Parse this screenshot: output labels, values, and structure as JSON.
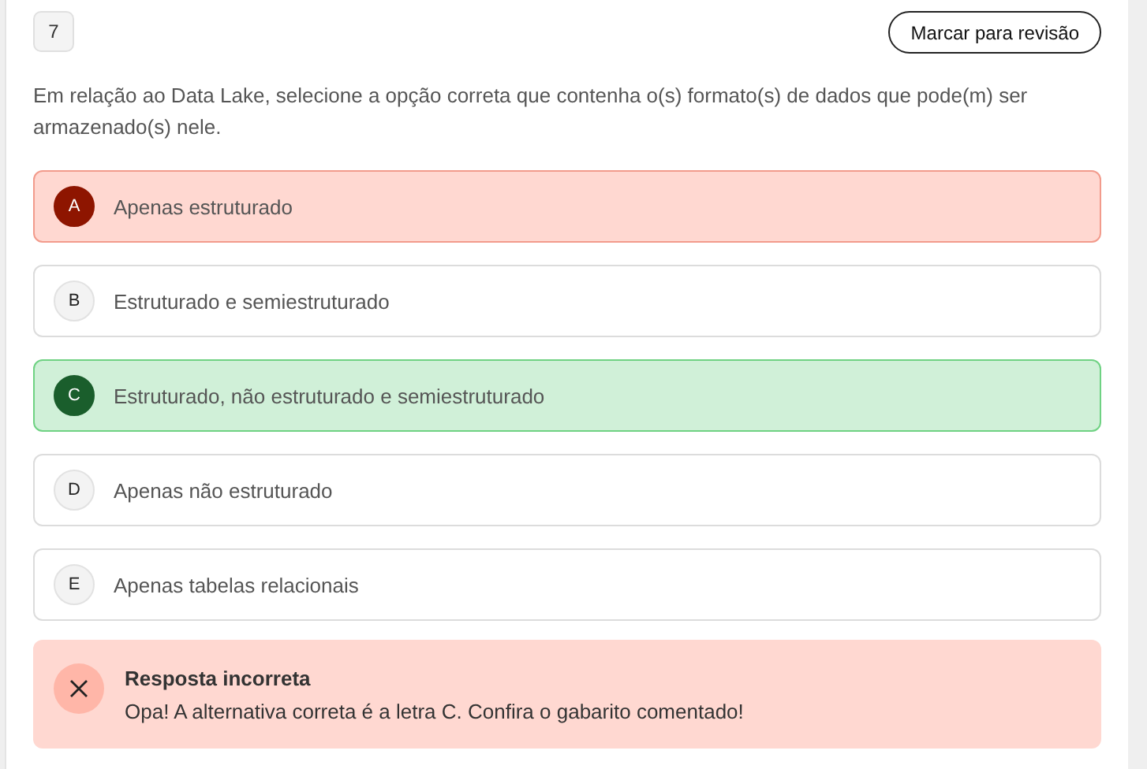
{
  "question": {
    "number": "7",
    "review_button": "Marcar para revisão",
    "text": "Em relação ao Data Lake, selecione a opção correta que contenha o(s) formato(s) de dados que pode(m) ser armazenado(s) nele."
  },
  "options": [
    {
      "letter": "A",
      "text": "Apenas estruturado",
      "selected": true,
      "correct": false
    },
    {
      "letter": "B",
      "text": "Estruturado e semiestruturado",
      "selected": false,
      "correct": false
    },
    {
      "letter": "C",
      "text": "Estruturado, não estruturado e semiestruturado",
      "selected": false,
      "correct": true
    },
    {
      "letter": "D",
      "text": "Apenas não estruturado",
      "selected": false,
      "correct": false
    },
    {
      "letter": "E",
      "text": "Apenas tabelas relacionais",
      "selected": false,
      "correct": false
    }
  ],
  "feedback": {
    "kind": "incorrect",
    "title": "Resposta incorreta",
    "message": "Opa! A alternativa correta é a letra C. Confira o gabarito comentado!"
  }
}
